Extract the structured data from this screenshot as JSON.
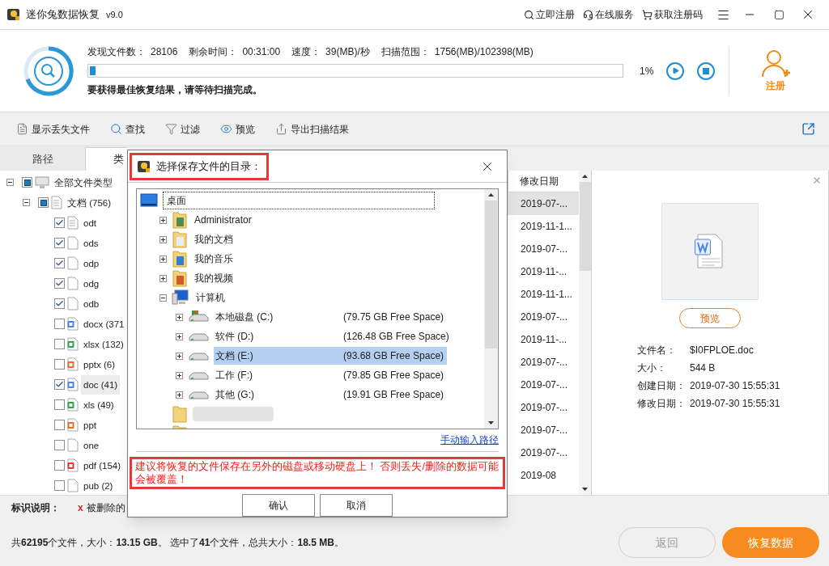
{
  "window": {
    "title": "迷你兔数据恢复",
    "version": "v9.0",
    "links": [
      "立即注册",
      "在线服务",
      "获取注册码"
    ]
  },
  "scan": {
    "stats": [
      {
        "label": "发现文件数：",
        "value": "28106"
      },
      {
        "label": "剩余时间：",
        "value": "00:31:00"
      },
      {
        "label": "速度：",
        "value": "39(MB)/秒"
      },
      {
        "label": "扫描范围：",
        "value": "1756(MB)/102398(MB)"
      }
    ],
    "level": 0.01,
    "percent": "1%",
    "hint": "要获得最佳恢复结果，请等待扫描完成。",
    "register": "注册"
  },
  "toolbar": [
    {
      "label": "显示丢失文件",
      "kind": "show"
    },
    {
      "label": "查找",
      "kind": "find"
    },
    {
      "label": "过滤",
      "kind": "filter"
    },
    {
      "label": "预览",
      "kind": "preview"
    },
    {
      "label": "导出扫描结果",
      "kind": "export"
    }
  ],
  "tabs": [
    {
      "label": "路径",
      "selected": false
    },
    {
      "label": "类",
      "selected": true
    }
  ],
  "type_tree": [
    {
      "label": "全部文件类型",
      "kind": "computer",
      "partial": true,
      "expanded": true,
      "selected": false,
      "children": [
        {
          "label": "文档 (756)",
          "kind": "page",
          "partial": true,
          "expanded": true,
          "selected": false,
          "children": [
            {
              "label": "odt",
              "kind": "text",
              "checked": true,
              "selected": false
            },
            {
              "label": "ods",
              "kind": "blank",
              "checked": true,
              "selected": false
            },
            {
              "label": "odp",
              "kind": "blank",
              "checked": true,
              "selected": false
            },
            {
              "label": "odg",
              "kind": "blank",
              "checked": true,
              "selected": false
            },
            {
              "label": "odb",
              "kind": "blank",
              "checked": true,
              "selected": false
            },
            {
              "label": "docx (371",
              "kind": "word",
              "checked": false,
              "selected": false
            },
            {
              "label": "xlsx (132)",
              "kind": "sheet",
              "checked": false,
              "selected": false
            },
            {
              "label": "pptx (6)",
              "kind": "slide",
              "checked": false,
              "selected": false
            },
            {
              "label": "doc (41)",
              "kind": "word",
              "checked": true,
              "selected": true
            },
            {
              "label": "xls (49)",
              "kind": "sheet",
              "checked": false,
              "selected": false
            },
            {
              "label": "ppt",
              "kind": "slide",
              "checked": false,
              "selected": false
            },
            {
              "label": "one",
              "kind": "blank",
              "checked": false,
              "selected": false
            },
            {
              "label": "pdf (154)",
              "kind": "pdf",
              "checked": false,
              "selected": false
            },
            {
              "label": "pub (2)",
              "kind": "blank",
              "checked": false,
              "selected": false
            }
          ]
        }
      ]
    }
  ],
  "file_list": {
    "column": "修改日期",
    "rows": [
      {
        "date": "2019-07-...",
        "selected": true
      },
      {
        "date": "2019-11-1...",
        "selected": false
      },
      {
        "date": "2019-07-...",
        "selected": false
      },
      {
        "date": "2019-11-...",
        "selected": false
      },
      {
        "date": "2019-11-1...",
        "selected": false
      },
      {
        "date": "2019-07-...",
        "selected": false
      },
      {
        "date": "2019-11-...",
        "selected": false
      },
      {
        "date": "2019-07-...",
        "selected": false
      },
      {
        "date": "2019-07-...",
        "selected": false
      },
      {
        "date": "2019-07-...",
        "selected": false
      },
      {
        "date": "2019-07-...",
        "selected": false
      },
      {
        "date": "2019-07-...",
        "selected": false
      },
      {
        "date": "2019-08",
        "selected": false
      }
    ]
  },
  "preview": {
    "button": "预览",
    "fields": [
      {
        "label": "文件名：",
        "value": "$I0FPLOE.doc"
      },
      {
        "label": "大小：",
        "value": "544 B"
      },
      {
        "label": "创建日期：",
        "value": "2019-07-30 15:55:31"
      },
      {
        "label": "修改日期：",
        "value": "2019-07-30 15:55:31"
      }
    ]
  },
  "legend": {
    "title": "标识说明：",
    "mark": "x",
    "text": "被删除的"
  },
  "status": {
    "summary": "共**62195**个文件，大小：**13.15 GB**。 选中了**41**个文件，总共大小：**18.5 MB**。",
    "buttons": [
      {
        "label": "返回",
        "disabled": true
      },
      {
        "label": "恢复数据",
        "disabled": false
      }
    ]
  },
  "dialog": {
    "title": "选择保存文件的目录：",
    "tree": [
      {
        "label": "桌面",
        "kind": "desktop",
        "selected": false,
        "focused": true,
        "children": [
          {
            "label": "Administrator",
            "kind": "user",
            "expanded": false,
            "selected": false
          },
          {
            "label": "我的文档",
            "kind": "docs",
            "expanded": false,
            "selected": false
          },
          {
            "label": "我的音乐",
            "kind": "music",
            "expanded": false,
            "selected": false
          },
          {
            "label": "我的视频",
            "kind": "video",
            "expanded": false,
            "selected": false
          },
          {
            "label": "计算机",
            "kind": "computer",
            "expanded": true,
            "selected": false,
            "children": [
              {
                "label": "本地磁盘 (C:)",
                "kind": "system-drive",
                "free": "(79.75 GB Free Space)",
                "expanded": false,
                "selected": false
              },
              {
                "label": "软件 (D:)",
                "kind": "drive",
                "free": "(126.48 GB Free Space)",
                "expanded": false,
                "selected": false
              },
              {
                "label": "文档 (E:)",
                "kind": "drive",
                "free": "(93.68 GB Free Space)",
                "expanded": false,
                "selected": true
              },
              {
                "label": "工作 (F:)",
                "kind": "drive",
                "free": "(79.85 GB Free Space)",
                "expanded": false,
                "selected": false
              },
              {
                "label": "其他 (G:)",
                "kind": "drive",
                "free": "(19.91 GB Free Space)",
                "expanded": false,
                "selected": false
              }
            ]
          },
          {
            "kind": "redacted",
            "selected": false
          },
          {
            "kind": "folder"
          }
        ]
      }
    ],
    "manual_link": "手动输入路径",
    "warning": "建议将恢复的文件保存在另外的磁盘或移动硬盘上！ 否则丢失/删除的数据可能会被覆盖！",
    "buttons": [
      "确认",
      "取消"
    ]
  }
}
